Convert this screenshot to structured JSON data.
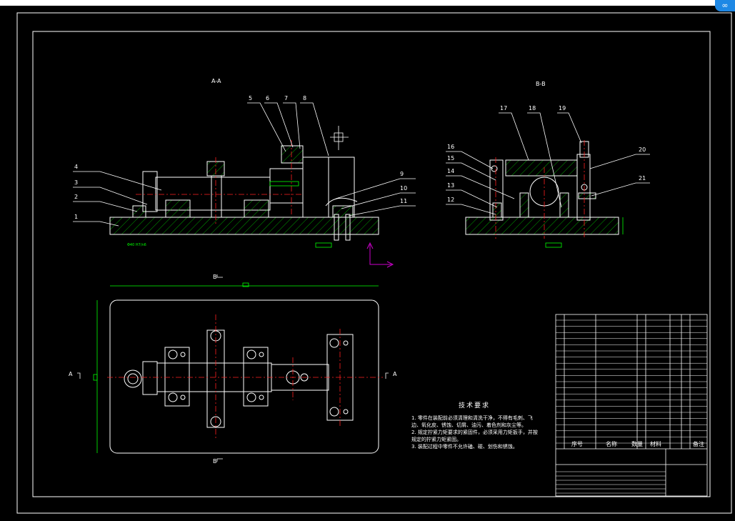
{
  "drawing": {
    "section_a_title": "A-A",
    "section_b_title": "B-B",
    "callouts": [
      "1",
      "2",
      "3",
      "4",
      "5",
      "6",
      "7",
      "8",
      "9",
      "10",
      "11",
      "12",
      "13",
      "14",
      "15",
      "16",
      "17",
      "18",
      "19",
      "20",
      "21"
    ],
    "view_arrow_top": "B",
    "view_arrow_bottom": "B",
    "view_arrow_left": "A",
    "view_arrow_right": "A",
    "dim_text": "Φ40 H7/n6"
  },
  "tech_requirements": {
    "title": "技术要求",
    "lines": [
      "1. 零件在装配前必须清理和清洗干净，不得有毛刺、飞边、氧化皮、锈蚀、切屑、油污、着色剂和灰尘等。",
      "2. 规定拧紧力矩要求的紧固件，必须采用力矩扳手，并按规定的拧紧力矩紧固。",
      "3. 装配过程中零件不允许磕、碰、划伤和锈蚀。"
    ]
  },
  "title_block": {
    "col_no": "序号",
    "col_name": "名称",
    "col_qty": "数量",
    "col_material": "材料",
    "col_note": "备注"
  },
  "colors": {
    "outline": "#ffffff",
    "section": "#00ff00",
    "center": "#ff0000",
    "hatch": "#00cc00",
    "leader": "#ffffff",
    "axis": "#cc00cc",
    "dimension": "#00ff00"
  }
}
